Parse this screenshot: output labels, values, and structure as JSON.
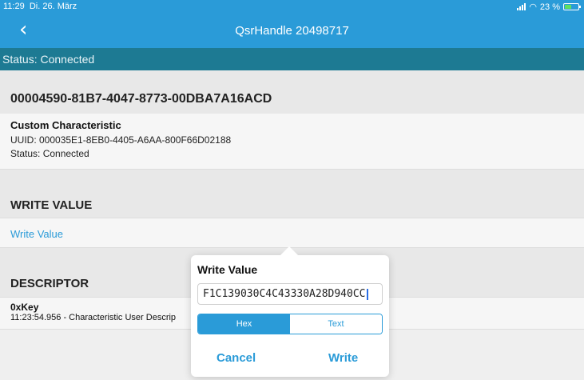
{
  "status_bar": {
    "time": "11:29",
    "date": "Di. 26. März",
    "battery": "23 %"
  },
  "nav": {
    "back_icon": "chevron-left",
    "title": "QsrHandle 20498717"
  },
  "connection": {
    "status": "Status: Connected"
  },
  "service": {
    "uuid": "00004590-81B7-4047-8773-00DBA7A16ACD"
  },
  "characteristic": {
    "name": "Custom Characteristic",
    "uuid": "UUID: 000035E1-8EB0-4405-A6AA-800F66D02188",
    "status": "Status: Connected"
  },
  "write_section": {
    "heading": "WRITE VALUE",
    "row_label": "Write Value"
  },
  "descriptor_section": {
    "heading": "DESCRIPTOR",
    "key": "0xKey",
    "value": "11:23:54.956 - Characteristic User Descrip"
  },
  "popup": {
    "title": "Write Value",
    "input_value": "F1C139030C4C43330A28D940CC",
    "segments": [
      "Hex",
      "Text"
    ],
    "selected_segment": "Hex",
    "cancel_label": "Cancel",
    "write_label": "Write"
  },
  "colors": {
    "accent": "#2a9bd8",
    "status_bar": "#1d7a93",
    "background": "#efefef"
  }
}
